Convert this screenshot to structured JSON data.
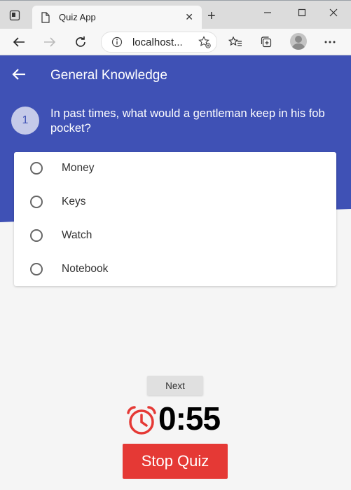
{
  "browser": {
    "tab_title": "Quiz App",
    "url": "localhost..."
  },
  "app": {
    "title": "General Knowledge",
    "question_number": "1",
    "question_text": "In past times, what would a gentleman keep in his fob pocket?",
    "options": [
      {
        "label": "Money",
        "selected": false
      },
      {
        "label": "Keys",
        "selected": false
      },
      {
        "label": "Watch",
        "selected": false
      },
      {
        "label": "Notebook",
        "selected": false
      }
    ],
    "next_label": "Next",
    "timer": "0:55",
    "stop_label": "Stop Quiz"
  },
  "colors": {
    "primary": "#3f51b5",
    "question_badge": "#c5cae9",
    "stop": "#e53935",
    "alarm": "#e53935"
  }
}
